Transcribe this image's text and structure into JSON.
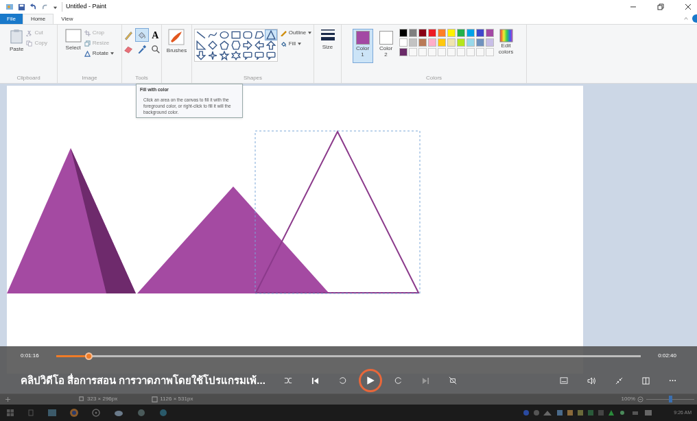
{
  "window": {
    "title": "Untitled - Paint"
  },
  "tabs": [
    {
      "label": "File",
      "kind": "file",
      "selected": false
    },
    {
      "label": "Home",
      "kind": "tab",
      "selected": true
    },
    {
      "label": "View",
      "kind": "tab",
      "selected": false
    }
  ],
  "clipboard": {
    "label": "Clipboard",
    "paste": "Paste",
    "cut": "Cut",
    "copy": "Copy"
  },
  "image": {
    "label": "Image",
    "select": "Select",
    "crop": "Crop",
    "resize": "Resize",
    "rotate": "Rotate"
  },
  "tools": {
    "label": "Tools",
    "items": [
      {
        "kind": "pencil",
        "selected": false
      },
      {
        "kind": "fill",
        "selected": true
      },
      {
        "kind": "text",
        "text": "A",
        "selected": false
      },
      {
        "kind": "eraser",
        "selected": false
      },
      {
        "kind": "picker",
        "selected": false
      },
      {
        "kind": "magnifier",
        "selected": false
      }
    ]
  },
  "brushes": {
    "label": "Brushes"
  },
  "shapes": {
    "label": "Shapes",
    "outline": "Outline",
    "fill": "Fill",
    "items": [
      {
        "kind": "line",
        "selected": false
      },
      {
        "kind": "curve",
        "selected": false
      },
      {
        "kind": "oval",
        "selected": false
      },
      {
        "kind": "rect",
        "selected": false
      },
      {
        "kind": "roundrect",
        "selected": false
      },
      {
        "kind": "polygon",
        "selected": false
      },
      {
        "kind": "triangle",
        "selected": true
      },
      {
        "kind": "righttriangle",
        "selected": false
      },
      {
        "kind": "diamond",
        "selected": false
      },
      {
        "kind": "pentagon",
        "selected": false
      },
      {
        "kind": "hexagon",
        "selected": false
      },
      {
        "kind": "arrowright",
        "selected": false
      },
      {
        "kind": "arrowleft",
        "selected": false
      },
      {
        "kind": "arrowup",
        "selected": false
      },
      {
        "kind": "arrowdown",
        "selected": false
      },
      {
        "kind": "star4",
        "selected": false
      },
      {
        "kind": "star5",
        "selected": false
      },
      {
        "kind": "star6",
        "selected": false
      },
      {
        "kind": "callout",
        "selected": false
      },
      {
        "kind": "callout",
        "selected": false
      },
      {
        "kind": "callout",
        "selected": false
      }
    ]
  },
  "size": {
    "label": "Size"
  },
  "colors": {
    "label": "Colors",
    "edit": "Edit colors",
    "color1": {
      "label": "Color 1",
      "color": "#a349a4",
      "selected": true
    },
    "color2": {
      "label": "Color 2",
      "color": "#ffffff",
      "selected": false
    },
    "palette": [
      {
        "color": "#000000"
      },
      {
        "color": "#7f7f7f"
      },
      {
        "color": "#880015"
      },
      {
        "color": "#ed1c24"
      },
      {
        "color": "#ff7f27"
      },
      {
        "color": "#fff200"
      },
      {
        "color": "#22b14c"
      },
      {
        "color": "#00a2e8"
      },
      {
        "color": "#3f48cc"
      },
      {
        "color": "#a349a4"
      },
      {
        "color": "#ffffff"
      },
      {
        "color": "#c3c3c3"
      },
      {
        "color": "#b97a57"
      },
      {
        "color": "#ffaec9"
      },
      {
        "color": "#ffc90e"
      },
      {
        "color": "#efe4b0"
      },
      {
        "color": "#b5e61d"
      },
      {
        "color": "#99d9ea"
      },
      {
        "color": "#7092be"
      },
      {
        "color": "#c8bfe7"
      },
      {
        "color": "#6a2a68"
      }
    ]
  },
  "tooltip": {
    "title": "Fill with color",
    "body": "Click an area on the canvas to fill it with the foreground color, or right-click to fill it will the background color."
  },
  "status_bar": {
    "selection_size": "323 × 296px",
    "canvas_size": "1126 × 531px",
    "zoom": "100%",
    "zoom_level": {
      "level": 0.5
    }
  },
  "player": {
    "elapsed": "0:01:16",
    "total": "0:02:40",
    "progress": {
      "level": 0.055
    },
    "title": "คลิปวิดีโอ สื่อการสอน การวาดภาพโดยใช้โปรแกรมเพ้..."
  },
  "taskbar": {
    "time": "9:26 AM"
  }
}
